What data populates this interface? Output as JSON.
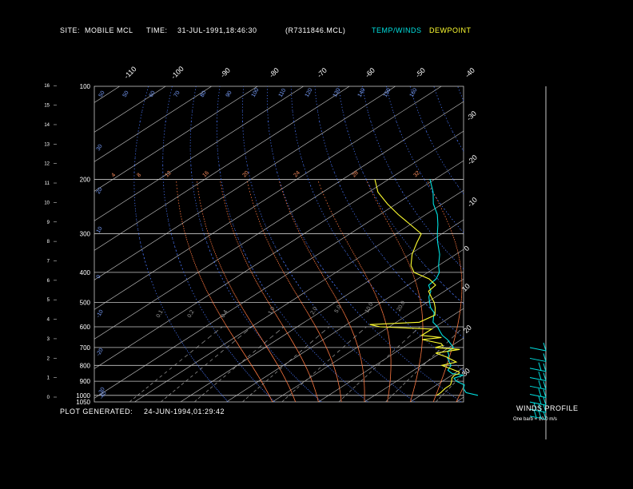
{
  "header": {
    "site_label": "SITE:",
    "site_value": "MOBILE MCL",
    "time_label": "TIME:",
    "time_value": "31-JUL-1991,18:46:30",
    "file": "(R7311846.MCL)",
    "legend_temp": "TEMP/WINDS",
    "legend_dew": "DEWPOINT"
  },
  "footer": {
    "generated_label": "PLOT GENERATED:",
    "generated_value": "24-JUN-1994,01:29:42",
    "winds_title": "WINDS PROFILE",
    "winds_note": "One barb = 10.0 m/s"
  },
  "colors": {
    "temp": "#00e0e0",
    "dew": "#ffff30",
    "grid": "#c8c8c8",
    "dry_adiabat": "#4a78ff",
    "moist_adiabat": "#ff7840",
    "mixing_ratio": "#a0a0a0",
    "text": "#ffffff",
    "label_blue": "#7aa0ff",
    "label_orange": "#ff9060"
  },
  "chart_data": {
    "type": "line",
    "title": "",
    "xlabel": "",
    "ylabel": "",
    "pressure_levels": [
      "100",
      "200",
      "300",
      "400",
      "500",
      "600",
      "700",
      "800",
      "900",
      "1000",
      "1050"
    ],
    "height_ticks": [
      "0",
      "1",
      "2",
      "3",
      "4",
      "5",
      "6",
      "7",
      "8",
      "9",
      "10",
      "11",
      "12",
      "13",
      "14",
      "15",
      "16"
    ],
    "isotherm_labels": [
      "-110",
      "-100",
      "-90",
      "-80",
      "-70",
      "-60",
      "-50",
      "-40",
      "-30",
      "-20",
      "-10",
      "0",
      "10",
      "20",
      "30"
    ],
    "dry_adiabat_labels_top": [
      "50",
      "50",
      "60",
      "70",
      "80",
      "90",
      "100",
      "110",
      "120",
      "130",
      "140",
      "150",
      "160"
    ],
    "dry_adiabat_labels_left": [
      "30",
      "20",
      "10",
      "0",
      "-10",
      "-20",
      "-30",
      "-40"
    ],
    "moist_labels": [
      "4",
      "8",
      "12",
      "16",
      "20",
      "24",
      "28",
      "32"
    ],
    "mixing_labels": [
      "0.1",
      "0.2",
      "0.4",
      "1.0",
      "2.0",
      "5.0",
      "10.0",
      "20.0"
    ],
    "series": [
      {
        "name": "TEMP/WINDS",
        "p": [
          1000,
          980,
          950,
          925,
          900,
          880,
          860,
          850,
          830,
          800,
          780,
          760,
          740,
          720,
          700,
          680,
          660,
          640,
          620,
          600,
          580,
          560,
          540,
          520,
          500,
          480,
          460,
          440,
          420,
          400,
          380,
          350,
          320,
          300,
          280,
          260,
          240,
          220,
          200
        ],
        "t": [
          32.5,
          29,
          27,
          26,
          23,
          21.5,
          22.5,
          19.5,
          17.5,
          16.5,
          15,
          13.5,
          12.5,
          11,
          11,
          9,
          7,
          4.5,
          2.5,
          0.5,
          -2,
          -3.5,
          -5,
          -7.5,
          -9.5,
          -11.5,
          -13,
          -15.5,
          -16,
          -17.5,
          -20,
          -23.5,
          -28,
          -31,
          -34,
          -37.5,
          -42,
          -46,
          -51
        ]
      },
      {
        "name": "DEWPOINT",
        "p": [
          1000,
          980,
          950,
          925,
          900,
          880,
          860,
          850,
          840,
          800,
          780,
          750,
          730,
          710,
          700,
          690,
          680,
          660,
          650,
          640,
          620,
          610,
          600,
          590,
          580,
          550,
          520,
          500,
          480,
          460,
          440,
          420,
          400,
          380,
          350,
          320,
          300,
          280,
          260,
          240,
          220,
          200
        ],
        "t": [
          23.5,
          23.5,
          23,
          23,
          22,
          21,
          20.5,
          21,
          20.5,
          14.5,
          16.5,
          12.5,
          9,
          13,
          7,
          8,
          7,
          1.5,
          5,
          0,
          0,
          0,
          -12,
          -15,
          -5,
          -4,
          -6.5,
          -8.5,
          -11,
          -13.5,
          -14,
          -17.5,
          -23,
          -26,
          -29.5,
          -32.5,
          -34.5,
          -40,
          -46,
          -52,
          -58,
          -63
        ]
      }
    ],
    "winds": {
      "note": "One barb = 10.0 m/s",
      "barbs": [
        {
          "p": 1000,
          "barbs": 3
        },
        {
          "p": 950,
          "barbs": 3
        },
        {
          "p": 900,
          "barbs": 2
        },
        {
          "p": 850,
          "barbs": 2
        },
        {
          "p": 800,
          "barbs": 2
        },
        {
          "p": 750,
          "barbs": 2
        },
        {
          "p": 700,
          "barbs": 2
        },
        {
          "p": 650,
          "barbs": 1
        },
        {
          "p": 600,
          "barbs": 1
        }
      ]
    }
  }
}
